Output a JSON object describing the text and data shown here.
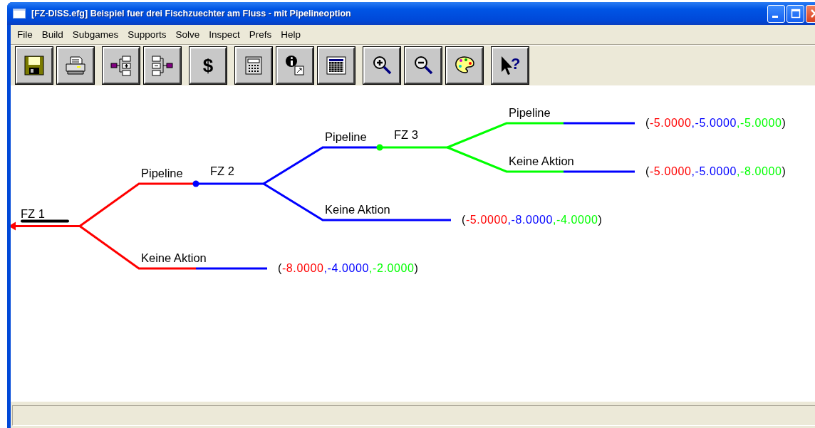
{
  "window": {
    "title": "[FZ-DISS.efg] Beispiel fuer drei Fischzuechter am Fluss - mit Pipelineoption"
  },
  "menu": [
    {
      "label": "File"
    },
    {
      "label": "Build"
    },
    {
      "label": "Subgames"
    },
    {
      "label": "Supports"
    },
    {
      "label": "Solve"
    },
    {
      "label": "Inspect"
    },
    {
      "label": "Prefs"
    },
    {
      "label": "Help"
    }
  ],
  "toolbar": [
    {
      "kind": "save"
    },
    {
      "kind": "print"
    },
    {
      "kind": "add-move",
      "separator_before": true
    },
    {
      "kind": "delete-move"
    },
    {
      "kind": "glyph",
      "glyph": "$",
      "separator_before": true
    },
    {
      "kind": "calculator",
      "separator_before": true
    },
    {
      "kind": "info"
    },
    {
      "kind": "table"
    },
    {
      "kind": "zoom-in",
      "separator_before": true
    },
    {
      "kind": "zoom-out"
    },
    {
      "kind": "palette"
    },
    {
      "kind": "help",
      "glyph": "?",
      "separator_before": true
    }
  ],
  "tree": {
    "label": "FZ 1",
    "color": "#ff0000",
    "selected": true,
    "branches": [
      {
        "action": "Pipeline",
        "node": {
          "label": "FZ 2",
          "color": "#0000ff",
          "selected": false,
          "branches": [
            {
              "action": "Pipeline",
              "node": {
                "label": "FZ 3",
                "color": "#00ff00",
                "selected": false,
                "branches": [
                  {
                    "action": "Pipeline",
                    "outcome": {
                      "open": "(",
                      "close": ")",
                      "payoffs": [
                        {
                          "value": "-5.0000",
                          "color": "#ff0000"
                        },
                        {
                          "value": ",-5.0000",
                          "color": "#0000ff"
                        },
                        {
                          "value": ",-5.0000",
                          "color": "#00ff00"
                        }
                      ]
                    }
                  },
                  {
                    "action": "Keine Aktion",
                    "outcome": {
                      "open": "(",
                      "close": ")",
                      "payoffs": [
                        {
                          "value": "-5.0000",
                          "color": "#ff0000"
                        },
                        {
                          "value": ",-5.0000",
                          "color": "#0000ff"
                        },
                        {
                          "value": ",-8.0000",
                          "color": "#00ff00"
                        }
                      ]
                    }
                  }
                ]
              }
            },
            {
              "action": "Keine Aktion",
              "outcome": {
                "open": "(",
                "close": ")",
                "payoffs": [
                  {
                    "value": "-5.0000",
                    "color": "#ff0000"
                  },
                  {
                    "value": ",-8.0000",
                    "color": "#0000ff"
                  },
                  {
                    "value": ",-4.0000",
                    "color": "#00ff00"
                  }
                ]
              }
            }
          ]
        }
      },
      {
        "action": "Keine Aktion",
        "outcome": {
          "open": "(",
          "close": ")",
          "payoffs": [
            {
              "value": "-8.0000",
              "color": "#ff0000"
            },
            {
              "value": ",-4.0000",
              "color": "#0000ff"
            },
            {
              "value": ",-2.0000",
              "color": "#00ff00"
            }
          ]
        }
      }
    ]
  }
}
